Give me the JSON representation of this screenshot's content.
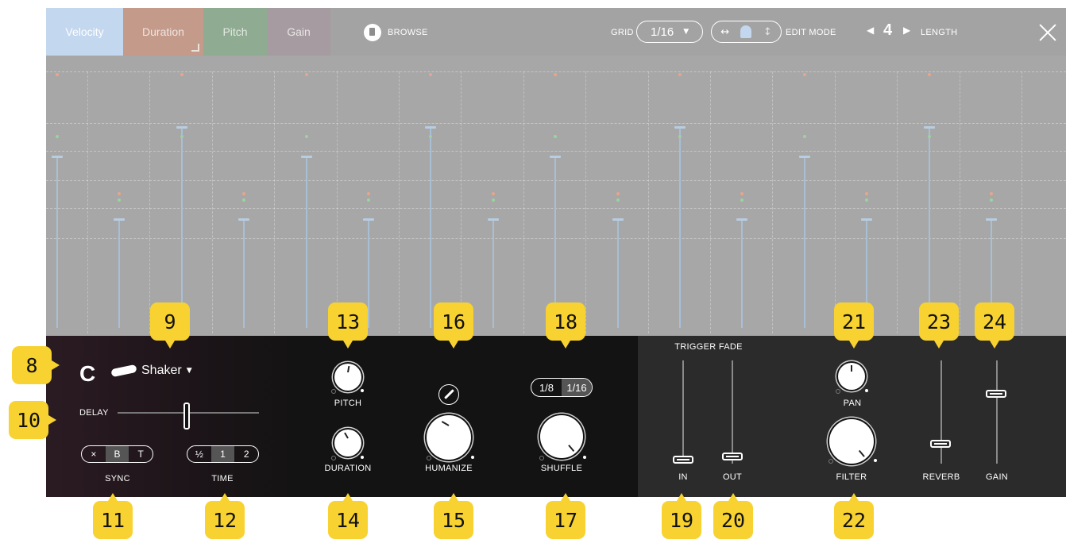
{
  "tabs": [
    {
      "label": "Velocity",
      "color": "#c3d7ef"
    },
    {
      "label": "Duration",
      "color": "#d6a999"
    },
    {
      "label": "Pitch",
      "color": "#8fb292"
    },
    {
      "label": "Gain",
      "color": "#aca2a8"
    }
  ],
  "header": {
    "browse_label": "BROWSE",
    "grid_label": "GRID",
    "grid_value": "1/16",
    "edit_mode_label": "EDIT MODE",
    "length_value": "4",
    "length_label": "LENGTH"
  },
  "sound": {
    "note": "C",
    "instrument": "Shaker",
    "instrument_icon": "shaker-icon",
    "delay_label": "DELAY",
    "sync_options": [
      "×",
      "B",
      "T"
    ],
    "sync_label": "SYNC",
    "time_options": [
      "½",
      "1",
      "2"
    ],
    "time_label": "TIME"
  },
  "controls": {
    "pitch_label": "PITCH",
    "duration_label": "DURATION",
    "humanize_label": "HUMANIZE",
    "shuffle_options": [
      "1/8",
      "1/16"
    ],
    "shuffle_label": "SHUFFLE",
    "trigger_fade_label": "TRIGGER FADE",
    "in_label": "IN",
    "out_label": "OUT",
    "pan_label": "PAN",
    "filter_label": "FILTER",
    "reverb_label": "REVERB",
    "gain_label": "GAIN"
  },
  "callouts": [
    "8",
    "9",
    "10",
    "11",
    "12",
    "13",
    "14",
    "15",
    "16",
    "17",
    "18",
    "19",
    "20",
    "21",
    "22",
    "23",
    "24"
  ],
  "colors": {
    "callout": "#f7d231",
    "velocity_bar": "#a8bfd6",
    "duration_dot": "#e8a58c",
    "pitch_dot": "#9cd39e"
  }
}
